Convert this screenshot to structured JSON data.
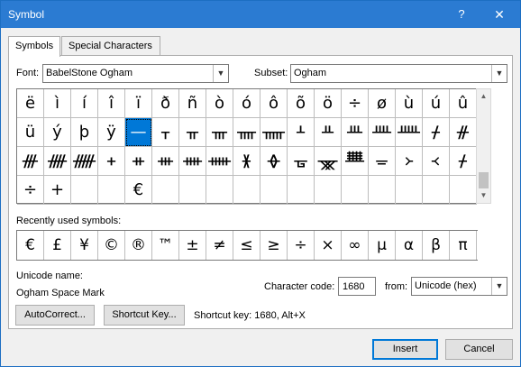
{
  "window": {
    "title": "Symbol",
    "help_glyph": "?",
    "close_glyph": "✕"
  },
  "tabs": [
    {
      "label": "Symbols",
      "active": true
    },
    {
      "label": "Special Characters",
      "active": false
    }
  ],
  "font": {
    "label": "Font:",
    "value": "BabelStone Ogham"
  },
  "subset": {
    "label": "Subset:",
    "value": "Ogham"
  },
  "symbol_grid": {
    "rows": [
      [
        "ë",
        "ì",
        "í",
        "î",
        "ï",
        "ð",
        "ñ",
        "ò",
        "ó",
        "ô",
        "õ",
        "ö",
        "÷",
        "ø",
        "ù",
        "ú",
        "û"
      ],
      [
        "ü",
        "ý",
        "þ",
        "ÿ",
        " ",
        "ᚁ",
        "ᚂ",
        "ᚃ",
        "ᚄ",
        "ᚅ",
        "ᚆ",
        "ᚇ",
        "ᚈ",
        "ᚉ",
        "ᚊ",
        "ᚋ",
        "ᚌ"
      ],
      [
        "ᚍ",
        "ᚎ",
        "ᚏ",
        "ᚐ",
        "ᚑ",
        "ᚒ",
        "ᚓ",
        "ᚔ",
        "ᚕ",
        "ᚖ",
        "ᚗ",
        "ᚘ",
        "ᚙ",
        "ᚚ",
        "᚛",
        "᚜",
        "ᚋ"
      ],
      [
        "÷",
        "+",
        "",
        "",
        "€",
        "",
        "",
        "",
        "",
        "",
        "",
        "",
        "",
        "",
        "",
        "",
        ""
      ]
    ],
    "selected": {
      "row": 1,
      "col": 4,
      "glyph": "—"
    }
  },
  "recently_used": {
    "label": "Recently used symbols:",
    "symbols": [
      "€",
      "£",
      "¥",
      "©",
      "®",
      "™",
      "±",
      "≠",
      "≤",
      "≥",
      "÷",
      "×",
      "∞",
      "µ",
      "α",
      "β",
      "π"
    ]
  },
  "unicode_name": {
    "label": "Unicode name:",
    "value": "Ogham Space Mark"
  },
  "character_code": {
    "label": "Character code:",
    "value": "1680"
  },
  "from": {
    "label": "from:",
    "value": "Unicode (hex)"
  },
  "buttons": {
    "autocorrect": "AutoCorrect...",
    "shortcut_key": "Shortcut Key...",
    "insert": "Insert",
    "cancel": "Cancel"
  },
  "shortcut_info": "Shortcut key: 1680, Alt+X",
  "icons": {
    "dropdown": "chevron-down-icon",
    "scroll_up": "triangle-up-icon",
    "scroll_down": "triangle-down-icon"
  },
  "colors": {
    "titlebar": "#2b7bd2",
    "selection": "#0078d7"
  }
}
